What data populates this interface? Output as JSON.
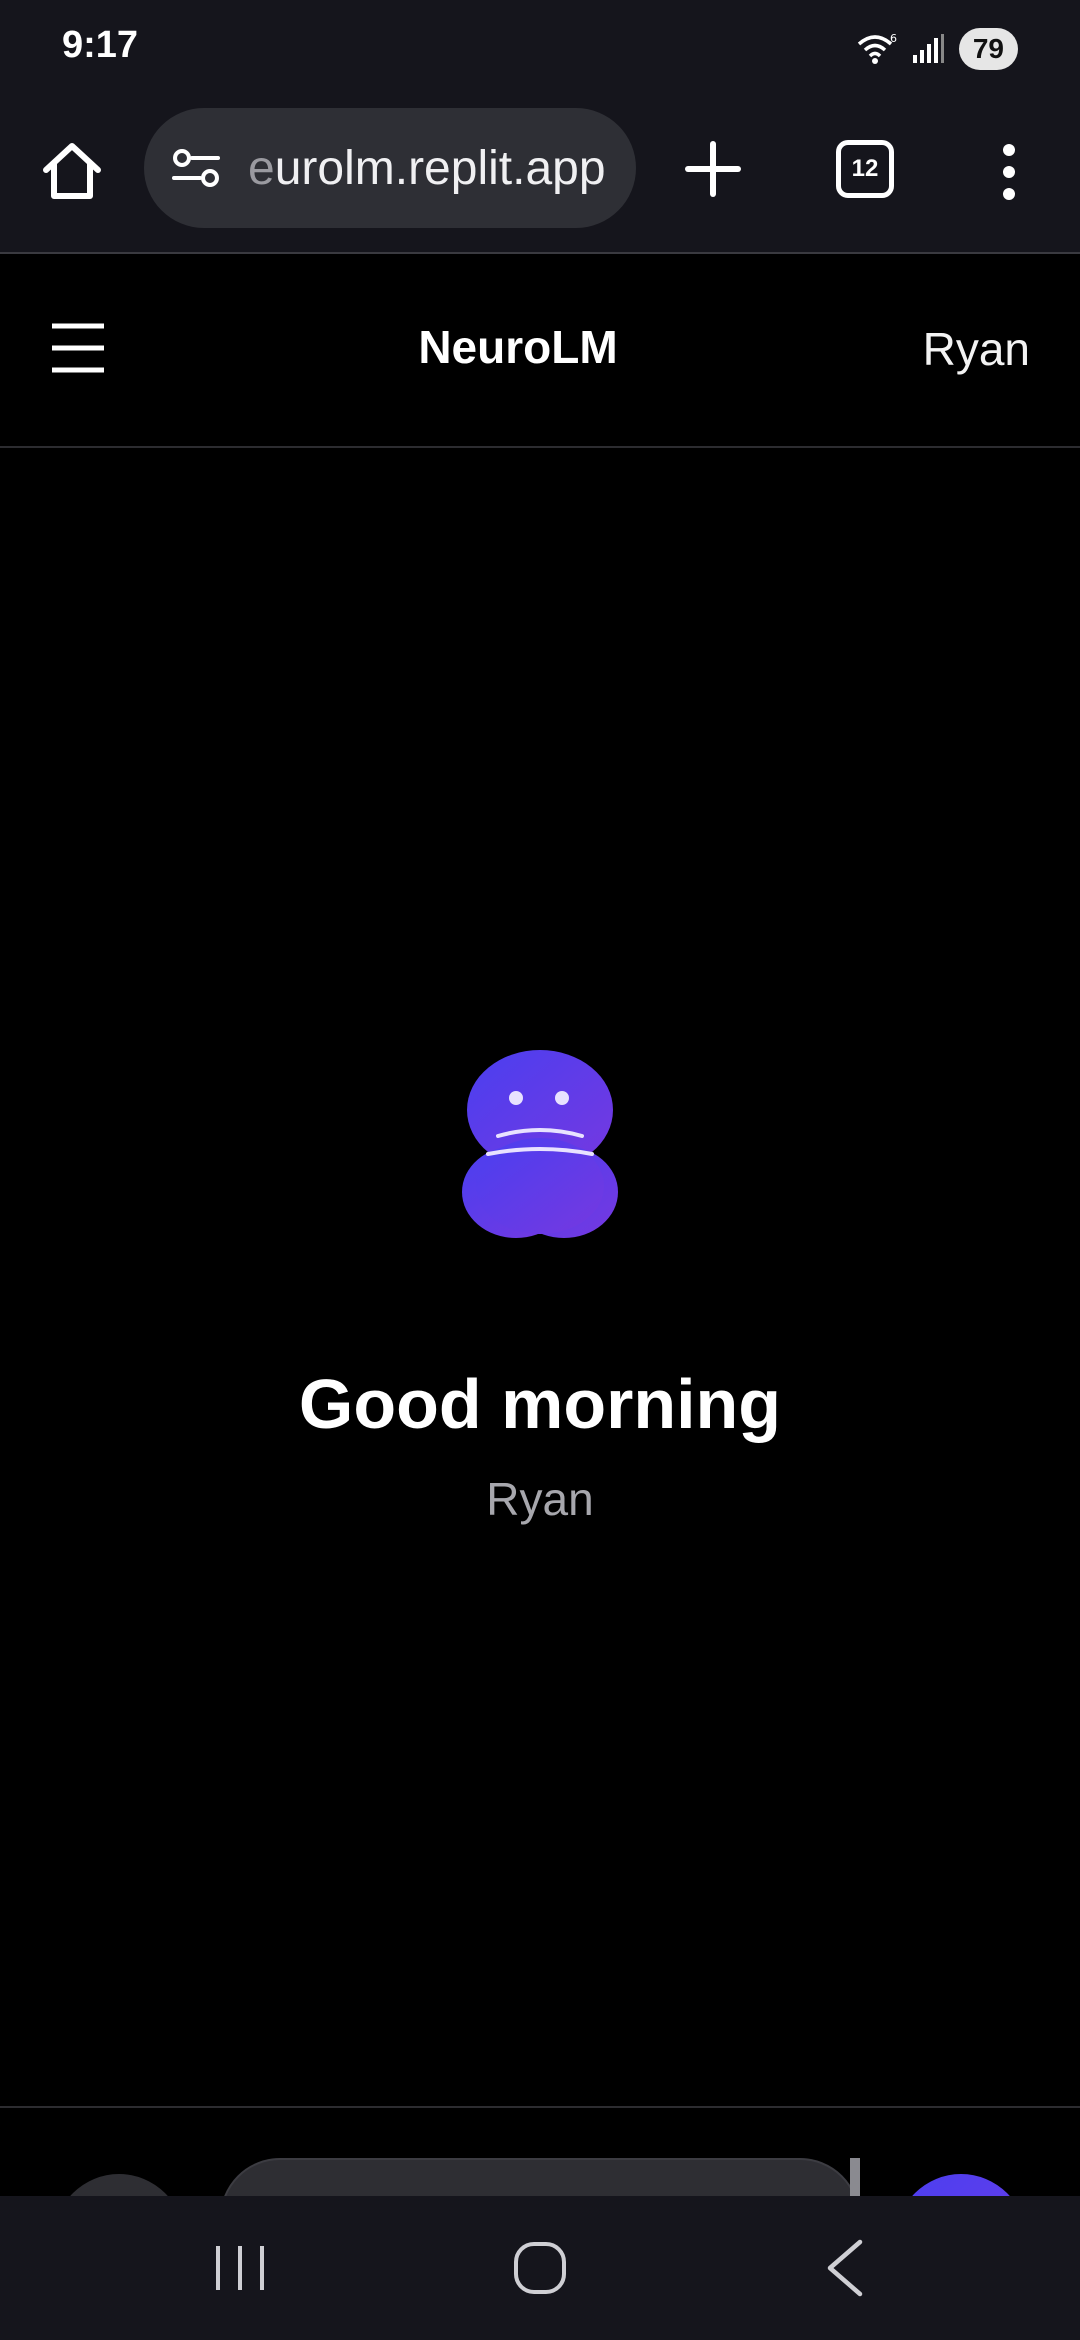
{
  "status_bar": {
    "time": "9:17",
    "wifi_icon": "wifi-6-icon",
    "signal_icon": "cell-signal-icon",
    "battery": "79"
  },
  "browser": {
    "home_icon": "home-icon",
    "site_settings_icon": "tune-icon",
    "url_fade_char": "e",
    "url_rest": "urolm.replit.app",
    "new_tab_icon": "plus-icon",
    "tab_count": "12",
    "menu_icon": "more-vert-icon"
  },
  "header": {
    "menu_icon": "hamburger-icon",
    "title": "NeuroLM",
    "user": "Ryan"
  },
  "main": {
    "logo_icon": "brain-icon",
    "greeting": "Good morning",
    "name": "Ryan"
  },
  "nav": {
    "recents_icon": "recents-icon",
    "home_icon": "home-circle-icon",
    "back_icon": "back-chevron-icon"
  },
  "colors": {
    "chrome_bg": "#15151c",
    "app_bg": "#000000",
    "accent_purple": "#5b3ff0",
    "muted_text": "#a7a7ad"
  }
}
